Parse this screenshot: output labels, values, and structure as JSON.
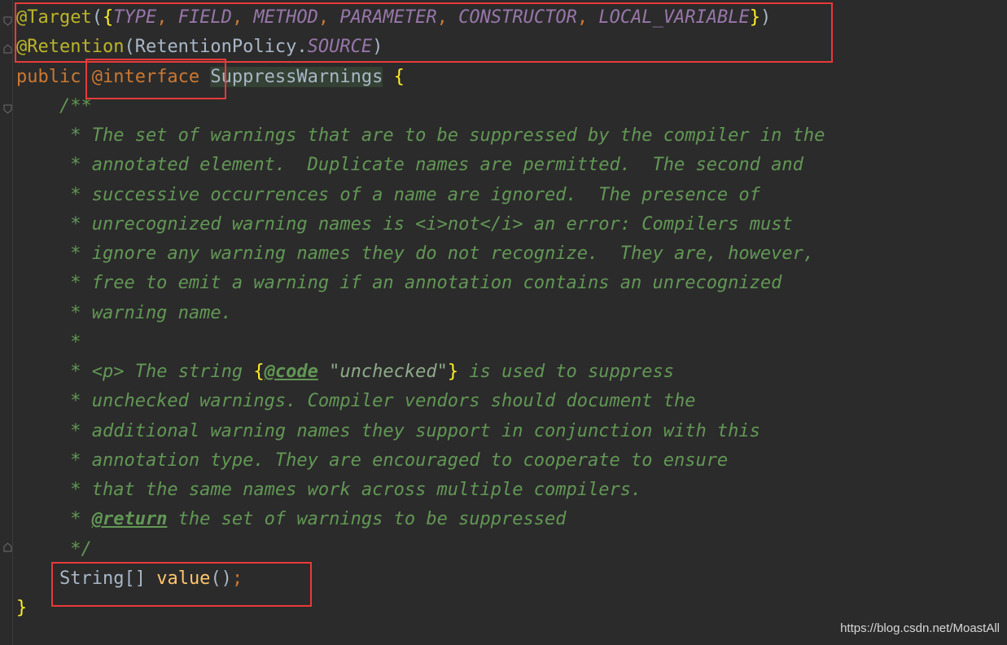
{
  "editor": {
    "lines": [
      [
        {
          "t": "@Target",
          "c": "ann"
        },
        {
          "t": "(",
          "c": "id"
        },
        {
          "t": "{",
          "c": "brace-hl"
        },
        {
          "t": "TYPE",
          "c": "const"
        },
        {
          "t": ", ",
          "c": "punct"
        },
        {
          "t": "FIELD",
          "c": "const"
        },
        {
          "t": ", ",
          "c": "punct"
        },
        {
          "t": "METHOD",
          "c": "const"
        },
        {
          "t": ", ",
          "c": "punct"
        },
        {
          "t": "PARAMETER",
          "c": "const"
        },
        {
          "t": ", ",
          "c": "punct"
        },
        {
          "t": "CONSTRUCTOR",
          "c": "const"
        },
        {
          "t": ", ",
          "c": "punct"
        },
        {
          "t": "LOCAL_VARIABLE",
          "c": "const"
        },
        {
          "t": "}",
          "c": "brace-hl"
        },
        {
          "t": ")",
          "c": "id"
        }
      ],
      [
        {
          "t": "@Retention",
          "c": "ann"
        },
        {
          "t": "(",
          "c": "id"
        },
        {
          "t": "RetentionPolicy",
          "c": "id"
        },
        {
          "t": ".",
          "c": "id"
        },
        {
          "t": "SOURCE",
          "c": "const"
        },
        {
          "t": ")",
          "c": "id"
        }
      ],
      [
        {
          "t": "public ",
          "c": "kw"
        },
        {
          "t": "@interface ",
          "c": "kw"
        },
        {
          "t": "SuppressWarnings",
          "c": "cls-hl"
        },
        {
          "t": " ",
          "c": "id"
        },
        {
          "t": "{",
          "c": "brace-hl"
        }
      ],
      [
        {
          "t": "    /**",
          "c": "comment"
        }
      ],
      [
        {
          "t": "     * The set of warnings that are to be suppressed by the compiler in the",
          "c": "comment"
        }
      ],
      [
        {
          "t": "     * annotated element.  Duplicate names are permitted.  The second and",
          "c": "comment"
        }
      ],
      [
        {
          "t": "     * successive occurrences of a name are ignored.  The presence of",
          "c": "comment"
        }
      ],
      [
        {
          "t": "     * unrecognized warning names is ",
          "c": "comment"
        },
        {
          "t": "<i>",
          "c": "tag"
        },
        {
          "t": "not",
          "c": "comment"
        },
        {
          "t": "</i>",
          "c": "tag"
        },
        {
          "t": " an error: Compilers must",
          "c": "comment"
        }
      ],
      [
        {
          "t": "     * ignore any warning names they do not recognize.  They are, however,",
          "c": "comment"
        }
      ],
      [
        {
          "t": "     * free to emit a warning if an annotation contains an unrecognized",
          "c": "comment"
        }
      ],
      [
        {
          "t": "     * warning name.",
          "c": "comment"
        }
      ],
      [
        {
          "t": "     *",
          "c": "comment"
        }
      ],
      [
        {
          "t": "     * ",
          "c": "comment"
        },
        {
          "t": "<p>",
          "c": "tag"
        },
        {
          "t": " The string ",
          "c": "comment"
        },
        {
          "t": "{",
          "c": "brace-hl"
        },
        {
          "t": "@code",
          "c": "doc-tag"
        },
        {
          "t": " \"unchecked\"",
          "c": "doc-str"
        },
        {
          "t": "}",
          "c": "brace-hl"
        },
        {
          "t": " is used to suppress",
          "c": "comment"
        }
      ],
      [
        {
          "t": "     * unchecked warnings. Compiler vendors should document the",
          "c": "comment"
        }
      ],
      [
        {
          "t": "     * additional warning names they support in conjunction with this",
          "c": "comment"
        }
      ],
      [
        {
          "t": "     * annotation type. They are encouraged to cooperate to ensure",
          "c": "comment"
        }
      ],
      [
        {
          "t": "     * that the same names work across multiple compilers.",
          "c": "comment"
        }
      ],
      [
        {
          "t": "     * ",
          "c": "comment"
        },
        {
          "t": "@return",
          "c": "doc-tag"
        },
        {
          "t": " the set of warnings to be suppressed",
          "c": "comment"
        }
      ],
      [
        {
          "t": "     */",
          "c": "comment"
        }
      ],
      [
        {
          "t": "    String",
          "c": "id"
        },
        {
          "t": "[] ",
          "c": "id"
        },
        {
          "t": "value",
          "c": "method"
        },
        {
          "t": "()",
          "c": "id"
        },
        {
          "t": ";",
          "c": "punct"
        }
      ],
      [
        {
          "t": "}",
          "c": "brace-hl"
        }
      ]
    ]
  },
  "watermark": "https://blog.csdn.net/MoastAll",
  "colors": {
    "background": "#2b2b2b",
    "annotation": "#bbb529",
    "keyword": "#cc7832",
    "constant": "#9876aa",
    "comment": "#629755",
    "method": "#ffc66d",
    "highlight_box": "#e83a3a"
  }
}
